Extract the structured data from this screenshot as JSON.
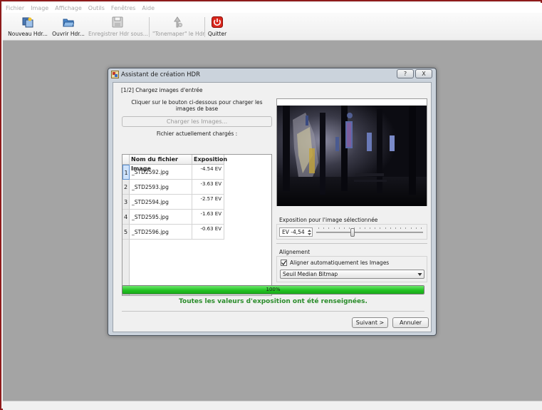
{
  "menu": [
    "Fichier",
    "Image",
    "Affichage",
    "Outils",
    "Fenêtres",
    "Aide"
  ],
  "toolbar": {
    "items": [
      {
        "label": "Nouveau Hdr...",
        "icon": "new-hdr-icon",
        "enabled": true
      },
      {
        "label": "Ouvrir Hdr...",
        "icon": "open-folder-icon",
        "enabled": true
      },
      {
        "label": "Enregistrer Hdr sous...",
        "icon": "save-disk-icon",
        "enabled": false
      },
      {
        "label": "\"Tonemaper\" le Hdr",
        "icon": "tonemap-icon",
        "enabled": false
      },
      {
        "label": "Quitter",
        "icon": "power-icon",
        "enabled": true
      }
    ]
  },
  "dialog": {
    "title": "Assistant de création HDR",
    "help_label": "?",
    "close_label": "X",
    "step_label": "[1/2] Chargez images d'entrée",
    "instruction": "Cliquer sur le bouton ci-dessous pour charger les images de base",
    "load_button": "Charger les Images...",
    "loaded_label": "Fichier actuellement chargés :",
    "table": {
      "headers": [
        "Nom du fichier Image",
        "Exposition"
      ],
      "rows": [
        {
          "num": "1",
          "name": "_STD2592.jpg",
          "ev": "-4.54 EV"
        },
        {
          "num": "2",
          "name": "_STD2593.jpg",
          "ev": "-3.63 EV"
        },
        {
          "num": "3",
          "name": "_STD2594.jpg",
          "ev": "-2.57 EV"
        },
        {
          "num": "4",
          "name": "_STD2595.jpg",
          "ev": "-1.63 EV"
        },
        {
          "num": "5",
          "name": "_STD2596.jpg",
          "ev": "-0.63 EV"
        }
      ]
    },
    "exposure_group_label": "Exposition pour l'image sélectionnée",
    "ev_spin_value": "EV -4,54",
    "slider_level": 0.33,
    "alignment_group_label": "Alignement",
    "align_checkbox_label": "Aligner automatiquement les Images",
    "align_checked": true,
    "align_method": "Seuil Median Bitmap",
    "progress_value": 1.0,
    "progress_text": "100%",
    "status_message": "Toutes les valeurs d'exposition ont été renseignées.",
    "next_button": "Suivant >",
    "cancel_button": "Annuler"
  },
  "colors": {
    "progress": "#22c222",
    "status": "#2a8c2a",
    "workspace": "#a4a4a4",
    "frame": "#8e1b1b"
  }
}
